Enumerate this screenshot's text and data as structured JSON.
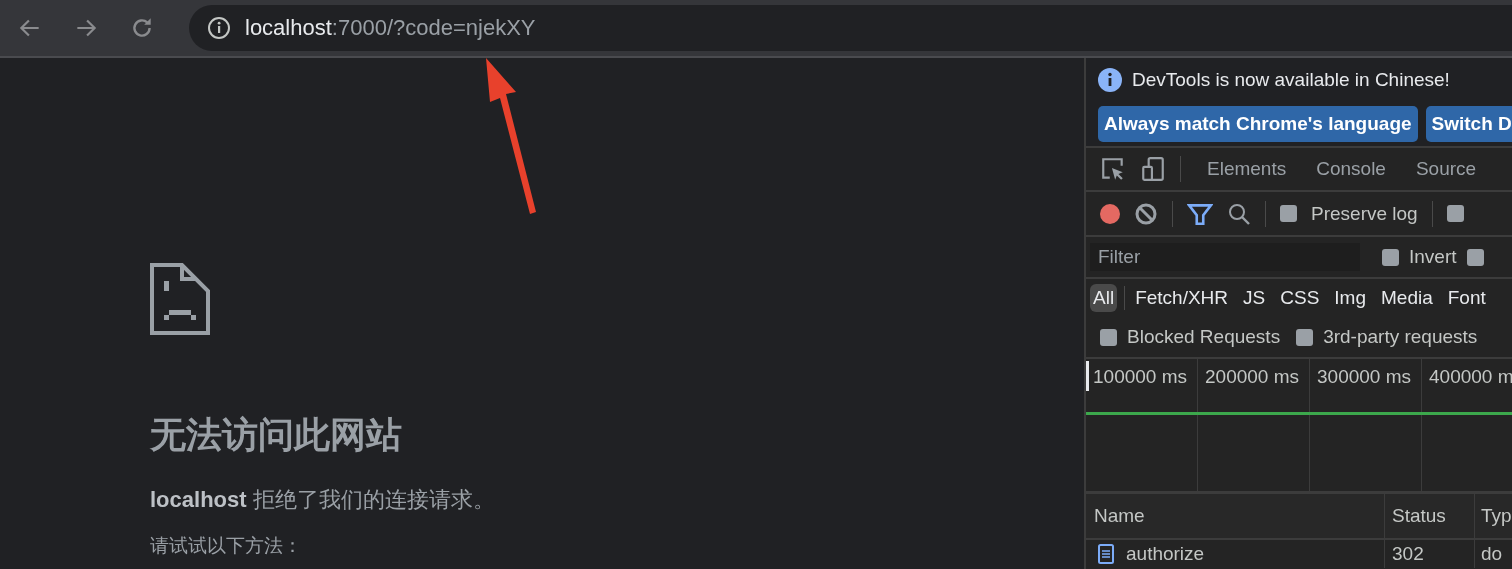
{
  "toolbar": {
    "url_host": "localhost",
    "url_rest": ":7000/?code=njekXY"
  },
  "error_page": {
    "title": "无法访问此网站",
    "host": "localhost",
    "message": "拒绝了我们的连接请求。",
    "hint": "请试试以下方法："
  },
  "devtools": {
    "infobar": {
      "message": "DevTools is now available in Chinese!",
      "buttons": [
        "Always match Chrome's language",
        "Switch D"
      ]
    },
    "tabs": [
      {
        "label": "Elements",
        "selected": false
      },
      {
        "label": "Console",
        "selected": false
      },
      {
        "label": "Source",
        "selected": false
      }
    ],
    "preserve_log": {
      "label": "Preserve log",
      "checked": false
    },
    "extra_checkbox": {
      "checked": false
    },
    "filter": {
      "placeholder": "Filter"
    },
    "invert": {
      "label": "Invert",
      "checked": false
    },
    "hide_checkbox": {
      "checked": false
    },
    "type_filters": [
      {
        "label": "All",
        "selected": true
      },
      {
        "label": "Fetch/XHR",
        "selected": false
      },
      {
        "label": "JS",
        "selected": false
      },
      {
        "label": "CSS",
        "selected": false
      },
      {
        "label": "Img",
        "selected": false
      },
      {
        "label": "Media",
        "selected": false
      },
      {
        "label": "Font",
        "selected": false
      }
    ],
    "options": [
      {
        "label": "Blocked Requests",
        "checked": false
      },
      {
        "label": "3rd-party requests",
        "checked": false
      }
    ],
    "timeline_ticks": [
      "100000 ms",
      "200000 ms",
      "300000 ms",
      "400000 m"
    ],
    "table": {
      "columns": [
        "Name",
        "Status",
        "Typ"
      ],
      "rows": [
        {
          "name": "authorize",
          "status": "302",
          "type": "do"
        }
      ]
    }
  }
}
